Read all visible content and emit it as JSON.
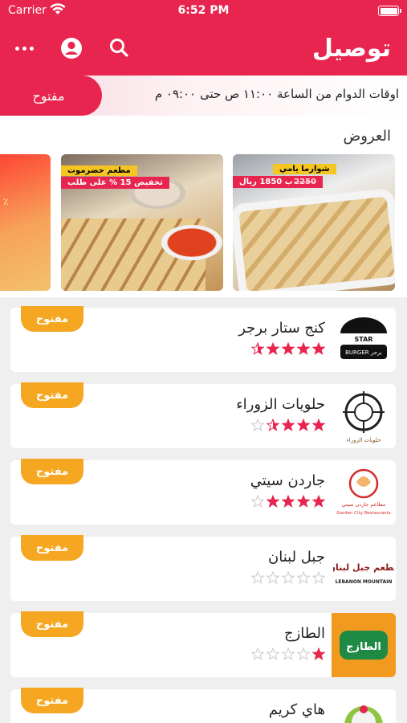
{
  "status_bar": {
    "carrier": "Carrier",
    "time": "6:52 PM"
  },
  "header": {
    "title": "توصيل",
    "icons": [
      "more-icon",
      "user-icon",
      "search-icon"
    ]
  },
  "hours": {
    "open_label": "مفتوح",
    "text": "اوقات الدوام من الساعة ١١:٠٠ ص حتى ٠٩:٠٠ م"
  },
  "offers": {
    "title": "العروض",
    "cards": [
      {
        "tag_top": "شوارما يامي",
        "old_price": "2250",
        "new_price": "ب 1850 ريال"
      },
      {
        "tag_top": "مطعم حضرموت",
        "discount": "تخفيض 15 % على طلب"
      },
      {
        "glyph": "٪"
      }
    ]
  },
  "restaurants": [
    {
      "name": "كنج ستار برجر",
      "rating": 4.5,
      "status": "مفتوح",
      "logo_text_top": "STAR",
      "logo_text_bottom": "BURGER برجر"
    },
    {
      "name": "حلويات الزوراء",
      "rating": 3.5,
      "status": "مفتوح",
      "logo_text_bottom": "حلويات الزوراء"
    },
    {
      "name": "جاردن سيتي",
      "rating": 4,
      "status": "مفتوح",
      "logo_text_top": "مطاعم جاردن سيتي",
      "logo_text_bottom": "Garden City Restaurants"
    },
    {
      "name": "جبل لبنان",
      "rating": 0,
      "status": "مفتوح",
      "logo_text_top": "مطعم جبل لبنان",
      "logo_text_bottom": "LEBANON MOUNTAIN"
    },
    {
      "name": "الطازج",
      "rating": 1,
      "status": "مفتوح",
      "logo_text_top": "الطازج"
    },
    {
      "name": "هاي كريم",
      "rating": 0,
      "status": "مفتوح"
    }
  ],
  "colors": {
    "primary": "#e8254f",
    "badge": "#f6a722",
    "star_on": "#e8254f",
    "star_off": "#c9c9c9"
  }
}
